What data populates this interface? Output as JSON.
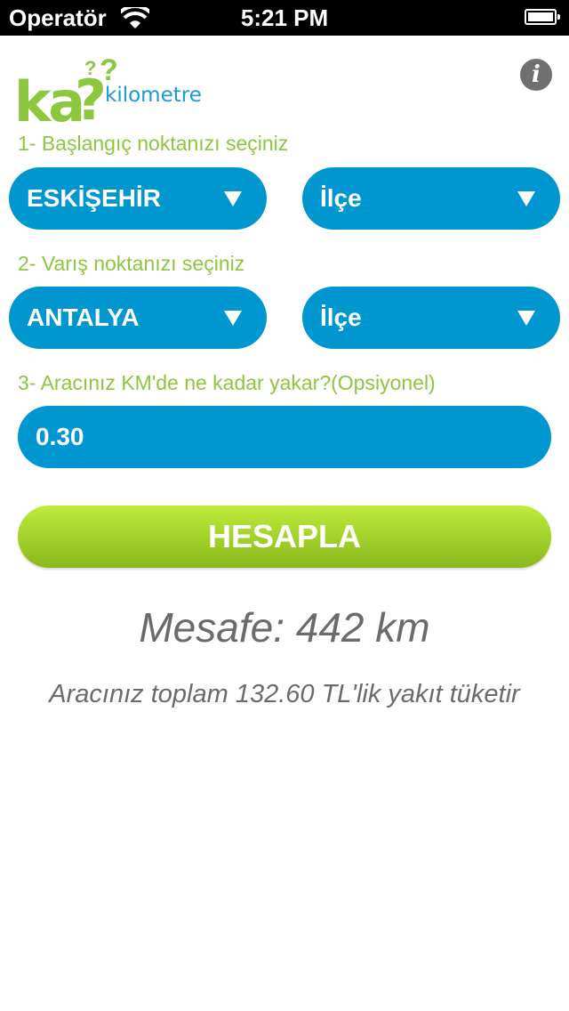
{
  "status_bar": {
    "carrier": "Operatör",
    "time": "5:21 PM"
  },
  "logo": {
    "ka": "ka",
    "qmark": "?",
    "kilometre": "kilometre"
  },
  "info_icon": "i",
  "step1": {
    "label": "1- Başlangıç noktanızı seçiniz",
    "city": "ESKİŞEHİR",
    "district": "İlçe"
  },
  "step2": {
    "label": "2- Varış noktanızı seçiniz",
    "city": "ANTALYA",
    "district": "İlçe"
  },
  "step3": {
    "label": "3- Aracınız KM'de ne kadar yakar?(Opsiyonel)",
    "value": "0.30"
  },
  "calculate_label": "HESAPLA",
  "result": {
    "distance": "Mesafe: 442 km",
    "fuel": "Aracınız toplam 132.60 TL'lik yakıt tüketir"
  },
  "colors": {
    "accent_blue": "#0096cf",
    "accent_green": "#8dc63f",
    "text_gray": "#6b6b6b"
  }
}
